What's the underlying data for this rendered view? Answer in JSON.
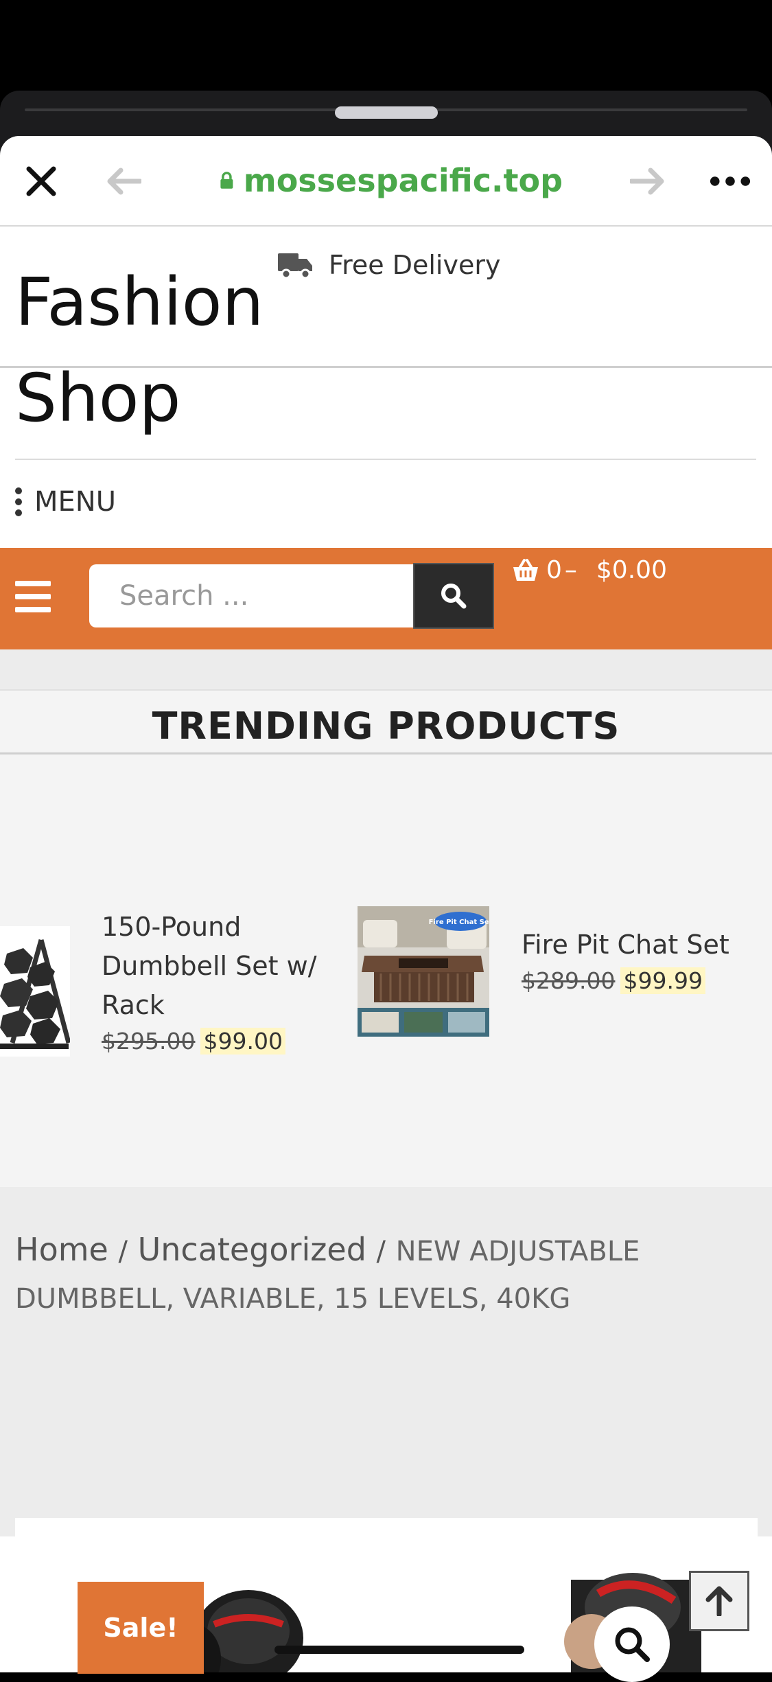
{
  "browser": {
    "url": "mossespacific.top",
    "close_icon": "close-icon",
    "back_icon": "arrow-left-icon",
    "forward_icon": "arrow-right-icon",
    "more_icon": "more-horizontal-icon",
    "lock_icon": "lock-icon",
    "url_color": "#4aa84a"
  },
  "topbar": {
    "delivery_text": "Free Delivery",
    "delivery_icon": "truck-icon"
  },
  "site": {
    "title": "Fashion Shop",
    "menu_label": "MENU"
  },
  "navbar": {
    "color": "#e07535",
    "search_placeholder": "Search ...",
    "cart_count": "0",
    "cart_dash": "–",
    "cart_total": "$0.00"
  },
  "trending": {
    "heading": "TRENDING PRODUCTS",
    "products": [
      {
        "name": "150-Pound Dumbbell Set w/ Rack",
        "old_price": "$295.00",
        "new_price": "$99.00"
      },
      {
        "name": "Fire Pit Chat Set",
        "old_price": "$289.00",
        "new_price": "$99.99",
        "image_text": "Fire Pit Chat Set"
      }
    ]
  },
  "breadcrumb": {
    "home": "Home",
    "sep": "/",
    "category": "Uncategorized",
    "current": "NEW ADJUSTABLE DUMBBELL, VARIABLE, 15 LEVELS, 40KG"
  },
  "product": {
    "sale_badge": "Sale!"
  }
}
